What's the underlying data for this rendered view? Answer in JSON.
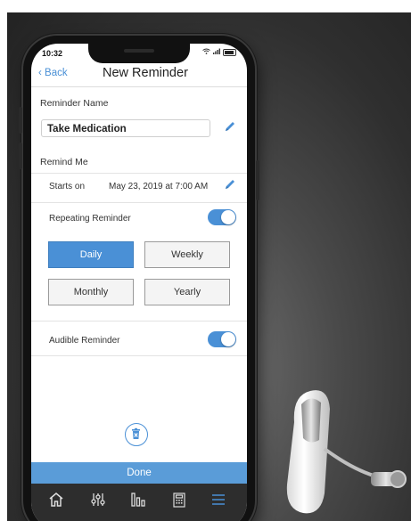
{
  "status_bar": {
    "time": "10:32"
  },
  "nav": {
    "back_label": "Back",
    "title": "New Reminder"
  },
  "form": {
    "reminder_name_label": "Reminder Name",
    "reminder_name_value": "Take Medication",
    "remind_me_label": "Remind Me",
    "starts_on_label": "Starts on",
    "starts_on_value": "May 23, 2019 at 7:00 AM",
    "repeating_label": "Repeating Reminder",
    "repeating_on": true,
    "frequency_options": [
      "Daily",
      "Weekly",
      "Monthly",
      "Yearly"
    ],
    "frequency_selected": "Daily",
    "audible_label": "Audible Reminder",
    "audible_on": true
  },
  "actions": {
    "done_label": "Done",
    "delete_icon": "trash-icon"
  },
  "tab_bar": {
    "icons": [
      "home-icon",
      "equalizer-icon",
      "bar-chart-icon",
      "calculator-icon",
      "menu-icon"
    ]
  },
  "colors": {
    "accent": "#4a90d6",
    "done_bar": "#5a9cd8",
    "tab_bar": "#2d2d2d",
    "background": "#3a3a3a"
  }
}
